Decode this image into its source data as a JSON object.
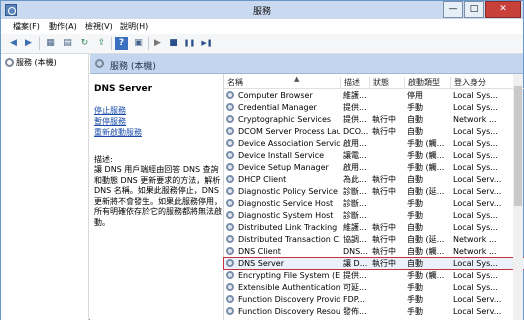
{
  "window": {
    "title": "服務",
    "buttons": {
      "minimize": "—",
      "maximize": "□",
      "close": "✕"
    }
  },
  "menu": [
    "檔案(F)",
    "動作(A)",
    "檢視(V)",
    "說明(H)"
  ],
  "toolbar": [
    {
      "icon": "back-icon",
      "glyph": "◀"
    },
    {
      "icon": "forward-icon",
      "glyph": "▶"
    },
    {
      "icon": "console-tree-icon",
      "glyph": "▦"
    },
    {
      "icon": "details-icon",
      "glyph": "▤"
    },
    {
      "icon": "refresh-icon",
      "glyph": "↻"
    },
    {
      "icon": "export-icon",
      "glyph": "⇪"
    },
    {
      "icon": "help-icon",
      "glyph": "?"
    },
    {
      "icon": "properties-icon",
      "glyph": "▣"
    },
    {
      "icon": "start-icon",
      "glyph": "▶"
    },
    {
      "icon": "stop-icon",
      "glyph": "■"
    },
    {
      "icon": "pause-icon",
      "glyph": "❚❚"
    },
    {
      "icon": "restart-icon",
      "glyph": "▶❚"
    }
  ],
  "tree": {
    "item": "服務 (本機)"
  },
  "pane": {
    "title": "服務 (本機)"
  },
  "detail": {
    "service_name": "DNS Server",
    "links": [
      "停止服務",
      "暫停服務",
      "重新啟動服務"
    ],
    "desc_label": "描述:",
    "desc_text": "讓 DNS 用戶端經由回答 DNS 查詢和動態 DNS 更新要求的方法，解析 DNS 名稱。如果此服務停止，DNS 更新將不會發生。如果此服務停用，所有明確依存於它的服務都將無法啟動。"
  },
  "table": {
    "headers": [
      "名稱",
      "描述",
      "狀態",
      "啟動類型",
      "登入身分"
    ],
    "rows": [
      {
        "name": "Computer Browser",
        "desc": "維護...",
        "status": "",
        "startup": "停用",
        "logon": "Local Sys..."
      },
      {
        "name": "Credential Manager",
        "desc": "提供...",
        "status": "",
        "startup": "手動",
        "logon": "Local Sys..."
      },
      {
        "name": "Cryptographic Services",
        "desc": "提供...",
        "status": "執行中",
        "startup": "自動",
        "logon": "Network ..."
      },
      {
        "name": "DCOM Server Process Lau...",
        "desc": "DCO...",
        "status": "執行中",
        "startup": "自動",
        "logon": "Local Sys..."
      },
      {
        "name": "Device Association Service",
        "desc": "啟用...",
        "status": "",
        "startup": "手動 (觸...",
        "logon": "Local Sys..."
      },
      {
        "name": "Device Install Service",
        "desc": "讓電...",
        "status": "",
        "startup": "手動 (觸...",
        "logon": "Local Sys..."
      },
      {
        "name": "Device Setup Manager",
        "desc": "啟用...",
        "status": "",
        "startup": "手動 (觸...",
        "logon": "Local Sys..."
      },
      {
        "name": "DHCP Client",
        "desc": "為此...",
        "status": "執行中",
        "startup": "自動",
        "logon": "Local Serv..."
      },
      {
        "name": "Diagnostic Policy Service",
        "desc": "診斷...",
        "status": "執行中",
        "startup": "自動 (延...",
        "logon": "Local Serv..."
      },
      {
        "name": "Diagnostic Service Host",
        "desc": "診斷...",
        "status": "",
        "startup": "手動",
        "logon": "Local Serv..."
      },
      {
        "name": "Diagnostic System Host",
        "desc": "診斷...",
        "status": "",
        "startup": "手動",
        "logon": "Local Sys..."
      },
      {
        "name": "Distributed Link Tracking ...",
        "desc": "維護...",
        "status": "執行中",
        "startup": "自動",
        "logon": "Local Sys..."
      },
      {
        "name": "Distributed Transaction C...",
        "desc": "協調...",
        "status": "執行中",
        "startup": "自動 (延...",
        "logon": "Network ..."
      },
      {
        "name": "DNS Client",
        "desc": "DNS...",
        "status": "執行中",
        "startup": "自動 (觸...",
        "logon": "Network ..."
      },
      {
        "name": "DNS Server",
        "desc": "讓 D...",
        "status": "執行中",
        "startup": "自動",
        "logon": "Local Sys...",
        "selected": true
      },
      {
        "name": "Encrypting File System (EFS)",
        "desc": "提供...",
        "status": "",
        "startup": "手動 (觸...",
        "logon": "Local Sys..."
      },
      {
        "name": "Extensible Authentication ...",
        "desc": "可延...",
        "status": "",
        "startup": "手動",
        "logon": "Local Sys..."
      },
      {
        "name": "Function Discovery Provid...",
        "desc": "FDP...",
        "status": "",
        "startup": "手動",
        "logon": "Local Serv..."
      },
      {
        "name": "Function Discovery Resou...",
        "desc": "發佈...",
        "status": "",
        "startup": "手動",
        "logon": "Local Serv..."
      }
    ]
  }
}
